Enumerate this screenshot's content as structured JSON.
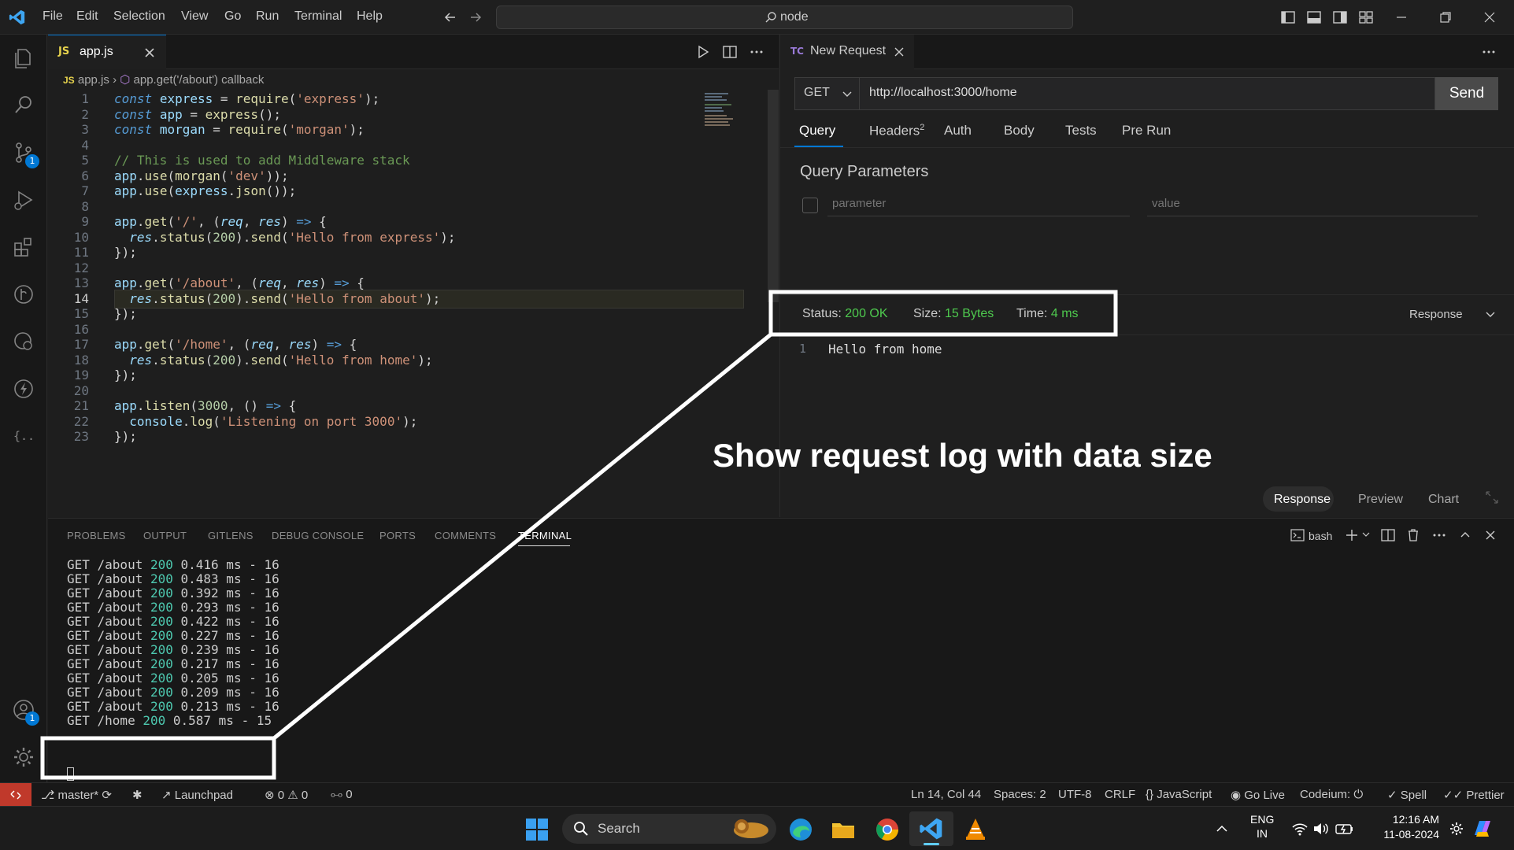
{
  "titlebar": {
    "menu": [
      "File",
      "Edit",
      "Selection",
      "View",
      "Go",
      "Run",
      "Terminal",
      "Help"
    ],
    "search_text": "node"
  },
  "activity": {
    "source_control_badge": "1",
    "accounts_badge": "1"
  },
  "editor": {
    "tab_icon": "JS",
    "tab_label": "app.js",
    "breadcrumb_file": "app.js",
    "breadcrumb_symbol": "app.get('/about') callback",
    "active_line": 14,
    "lines": [
      {
        "num": "1",
        "text": "const express = require('express');"
      },
      {
        "num": "2",
        "text": "const app = express();"
      },
      {
        "num": "3",
        "text": "const morgan = require('morgan');"
      },
      {
        "num": "4",
        "text": ""
      },
      {
        "num": "5",
        "text": "// This is used to add Middleware stack"
      },
      {
        "num": "6",
        "text": "app.use(morgan('dev'));"
      },
      {
        "num": "7",
        "text": "app.use(express.json());"
      },
      {
        "num": "8",
        "text": ""
      },
      {
        "num": "9",
        "text": "app.get('/', (req, res) => {"
      },
      {
        "num": "10",
        "text": "  res.status(200).send('Hello from express');"
      },
      {
        "num": "11",
        "text": "});"
      },
      {
        "num": "12",
        "text": ""
      },
      {
        "num": "13",
        "text": "app.get('/about', (req, res) => {"
      },
      {
        "num": "14",
        "text": "  res.status(200).send('Hello from about');"
      },
      {
        "num": "15",
        "text": "});"
      },
      {
        "num": "16",
        "text": ""
      },
      {
        "num": "17",
        "text": "app.get('/home', (req, res) => {"
      },
      {
        "num": "18",
        "text": "  res.status(200).send('Hello from home');"
      },
      {
        "num": "19",
        "text": "});"
      },
      {
        "num": "20",
        "text": ""
      },
      {
        "num": "21",
        "text": "app.listen(3000, () => {"
      },
      {
        "num": "22",
        "text": "  console.log('Listening on port 3000');"
      },
      {
        "num": "23",
        "text": "});"
      }
    ]
  },
  "thunder": {
    "tab_icon": "TC",
    "tab_label": "New Request",
    "method": "GET",
    "url": "http://localhost:3000/home",
    "send_label": "Send",
    "request_tabs": [
      "Query",
      "Headers",
      "Auth",
      "Body",
      "Tests",
      "Pre Run"
    ],
    "headers_count": "2",
    "query_title": "Query Parameters",
    "param_placeholder": "parameter",
    "value_placeholder": "value",
    "status_label": "Status:",
    "status_value": "200 OK",
    "size_label": "Size:",
    "size_value": "15 Bytes",
    "time_label": "Time:",
    "time_value": "4 ms",
    "response_dropdown": "Response",
    "response_line_num": "1",
    "response_body": "Hello from home",
    "response_tabs": [
      "Response",
      "Preview",
      "Chart"
    ]
  },
  "annotation": {
    "caption": "Show request log with data size"
  },
  "panel": {
    "tabs": [
      "PROBLEMS",
      "OUTPUT",
      "GITLENS",
      "DEBUG CONSOLE",
      "PORTS",
      "COMMENTS",
      "TERMINAL"
    ],
    "shell": "bash",
    "terminal_lines": [
      {
        "pre": "GET /about ",
        "code": "200",
        "post": " 0.416 ms - 16"
      },
      {
        "pre": "GET /about ",
        "code": "200",
        "post": " 0.483 ms - 16"
      },
      {
        "pre": "GET /about ",
        "code": "200",
        "post": " 0.392 ms - 16"
      },
      {
        "pre": "GET /about ",
        "code": "200",
        "post": " 0.293 ms - 16"
      },
      {
        "pre": "GET /about ",
        "code": "200",
        "post": " 0.422 ms - 16"
      },
      {
        "pre": "GET /about ",
        "code": "200",
        "post": " 0.227 ms - 16"
      },
      {
        "pre": "GET /about ",
        "code": "200",
        "post": " 0.239 ms - 16"
      },
      {
        "pre": "GET /about ",
        "code": "200",
        "post": " 0.217 ms - 16"
      },
      {
        "pre": "GET /about ",
        "code": "200",
        "post": " 0.205 ms - 16"
      },
      {
        "pre": "GET /about ",
        "code": "200",
        "post": " 0.209 ms - 16"
      },
      {
        "pre": "GET /about ",
        "code": "200",
        "post": " 0.213 ms - 16"
      },
      {
        "pre": "GET /home ",
        "code": "200",
        "post": " 0.587 ms - 15"
      }
    ]
  },
  "statusbar": {
    "branch": "master*",
    "launchpad": "Launchpad",
    "errors": "0",
    "warnings": "0",
    "ports": "0",
    "position": "Ln 14, Col 44",
    "spaces": "Spaces: 2",
    "encoding": "UTF-8",
    "eol": "CRLF",
    "language": "JavaScript",
    "golive": "Go Live",
    "codeium": "Codeium:",
    "spell": "Spell",
    "prettier": "Prettier"
  },
  "taskbar": {
    "search_label": "Search",
    "lang_line1": "ENG",
    "lang_line2": "IN",
    "time": "12:16 AM",
    "date": "11-08-2024"
  },
  "colors": {
    "accent": "#0078d4",
    "status_ok": "#4ec94e",
    "annotation_stroke": "#ffffff"
  }
}
